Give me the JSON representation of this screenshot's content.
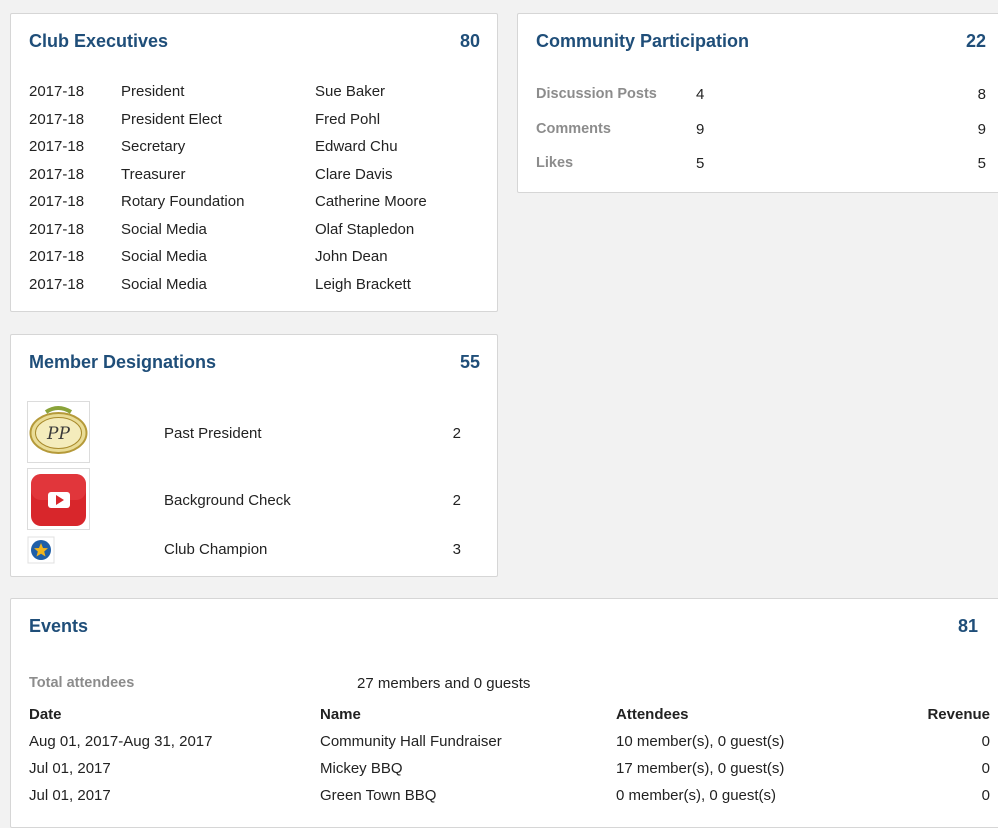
{
  "club_executives": {
    "title": "Club Executives",
    "count": "80",
    "rows": [
      {
        "year": "2017-18",
        "role": "President",
        "name": "Sue Baker"
      },
      {
        "year": "2017-18",
        "role": "President Elect",
        "name": "Fred Pohl"
      },
      {
        "year": "2017-18",
        "role": "Secretary",
        "name": "Edward Chu"
      },
      {
        "year": "2017-18",
        "role": "Treasurer",
        "name": "Clare Davis"
      },
      {
        "year": "2017-18",
        "role": "Rotary Foundation",
        "name": "Catherine Moore"
      },
      {
        "year": "2017-18",
        "role": "Social Media",
        "name": "Olaf Stapledon"
      },
      {
        "year": "2017-18",
        "role": "Social Media",
        "name": "John Dean"
      },
      {
        "year": "2017-18",
        "role": "Social Media",
        "name": "Leigh Brackett"
      }
    ]
  },
  "community_participation": {
    "title": "Community Participation",
    "count": "22",
    "rows": [
      {
        "label": "Discussion Posts",
        "value": "4",
        "end": "8"
      },
      {
        "label": "Comments",
        "value": "9",
        "end": "9"
      },
      {
        "label": "Likes",
        "value": "5",
        "end": "5"
      }
    ]
  },
  "member_designations": {
    "title": "Member Designations",
    "count": "55",
    "rows": [
      {
        "icon": "past-president-badge-icon",
        "label": "Past President",
        "count": "2",
        "badge_text": "PP"
      },
      {
        "icon": "youtube-play-icon",
        "label": "Background Check",
        "count": "2"
      },
      {
        "icon": "star-badge-icon",
        "label": "Club Champion",
        "count": "3"
      }
    ]
  },
  "events": {
    "title": "Events",
    "count": "81",
    "total_label": "Total attendees",
    "total_value": "27 members and 0 guests",
    "columns": {
      "date": "Date",
      "name": "Name",
      "attendees": "Attendees",
      "revenue": "Revenue"
    },
    "rows": [
      {
        "date": "Aug 01, 2017-Aug 31, 2017",
        "name": "Community Hall Fundraiser",
        "attendees": "10 member(s), 0 guest(s)",
        "revenue": "0"
      },
      {
        "date": "Jul 01, 2017",
        "name": "Mickey BBQ",
        "attendees": "17 member(s), 0 guest(s)",
        "revenue": "0"
      },
      {
        "date": "Jul 01, 2017",
        "name": "Green Town BBQ",
        "attendees": "0 member(s), 0 guest(s)",
        "revenue": "0"
      }
    ]
  },
  "colors": {
    "title_blue": "#1f4e79",
    "muted_label": "#8c8c8c",
    "youtube_red": "#d8262b",
    "badge_gold": "#e9dc96"
  }
}
